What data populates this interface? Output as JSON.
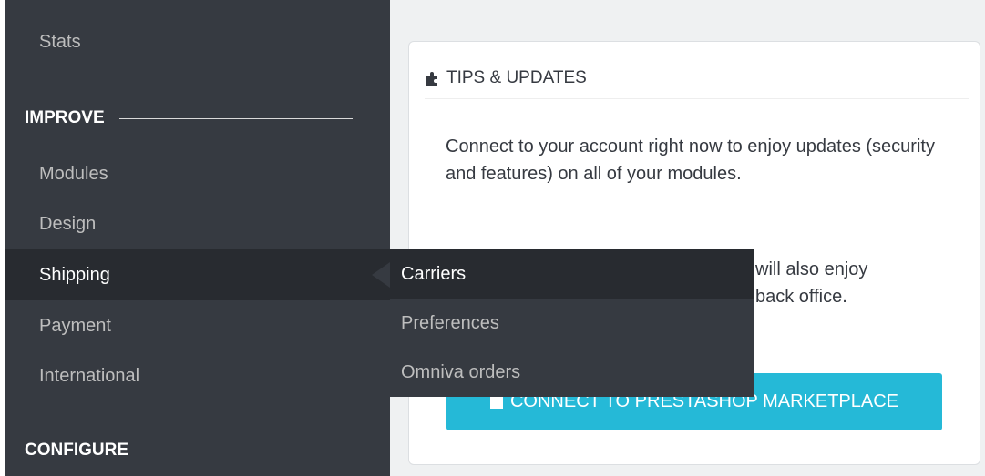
{
  "sidebar": {
    "items_top": [
      {
        "label": "Stats"
      }
    ],
    "sections": [
      {
        "title": "IMPROVE"
      },
      {
        "title": "CONFIGURE"
      }
    ],
    "improve_items": [
      {
        "label": "Modules"
      },
      {
        "label": "Design"
      },
      {
        "label": "Shipping",
        "active": true
      },
      {
        "label": "Payment"
      },
      {
        "label": "International"
      }
    ]
  },
  "submenu": {
    "items": [
      {
        "label": "Carriers",
        "active": true
      },
      {
        "label": "Preferences"
      },
      {
        "label": "Omniva orders"
      }
    ]
  },
  "panel": {
    "title": "TIPS & UPDATES",
    "paragraph1": "Connect to your account right now to enjoy updates (security and features) on all of your modules.",
    "paragraph2_visible_line1": "will also enjoy",
    "paragraph2_visible_line2": "back office.",
    "button_label": "CONNECT TO PRESTASHOP MARKETPLACE"
  },
  "colors": {
    "sidebar_bg": "#363a41",
    "active_bg": "#282b30",
    "accent": "#25b9d7",
    "content_bg": "#eff1f2"
  },
  "icons": {
    "panel_heading": "puzzle-icon",
    "button": "user-icon"
  }
}
